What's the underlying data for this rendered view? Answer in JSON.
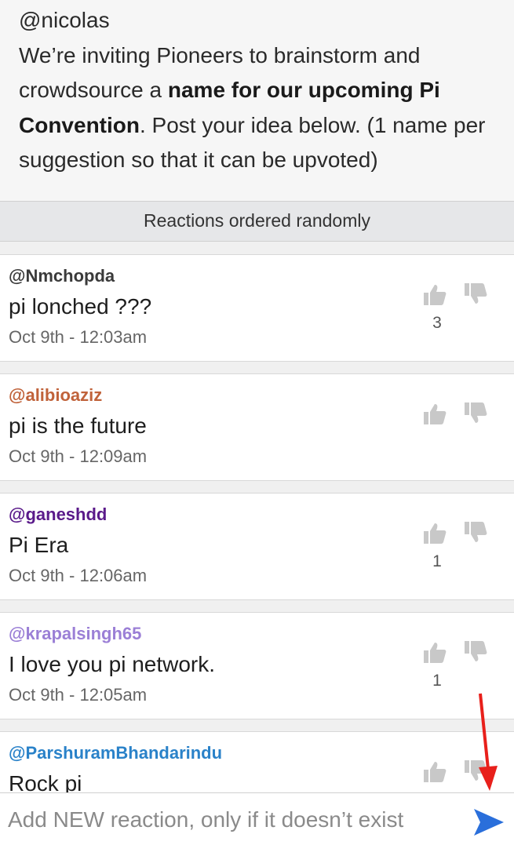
{
  "post": {
    "author": "@nicolas",
    "text_before": "We’re inviting Pioneers to brainstorm and crowdsource a ",
    "text_bold": "name for our upcoming Pi Convention",
    "text_after": ". Post your idea below. (1 name per suggestion so that it can be upvoted)"
  },
  "reactions_header": "Reactions ordered randomly",
  "reactions": [
    {
      "user": "@Nmchopda",
      "user_color": "#3a3a3a",
      "text": "pi lonched ???",
      "time": "Oct 9th - 12:03am",
      "votes": "3"
    },
    {
      "user": "@alibioaziz",
      "user_color": "#c0623a",
      "text": "pi is the future",
      "time": "Oct 9th - 12:09am",
      "votes": ""
    },
    {
      "user": "@ganeshdd",
      "user_color": "#5a1a8a",
      "text": "Pi Era",
      "time": "Oct 9th - 12:06am",
      "votes": "1"
    },
    {
      "user": "@krapalsingh65",
      "user_color": "#9b7fd6",
      "text": "I love you pi network.",
      "time": "Oct 9th - 12:05am",
      "votes": "1"
    },
    {
      "user": "@ParshuramBhandarindu",
      "user_color": "#2a82c9",
      "text": "Rock pi",
      "time": "",
      "votes": ""
    }
  ],
  "composer": {
    "placeholder": "Add NEW reaction, only if it doesn’t exist",
    "value": ""
  },
  "icons": {
    "upvote": "thumbs-up-icon",
    "downvote": "thumbs-down-icon",
    "send": "send-arrow-icon"
  },
  "colors": {
    "icon_gray": "#c8c8c8",
    "send_blue": "#2a6fdb",
    "annotation_red": "#e8201b"
  }
}
